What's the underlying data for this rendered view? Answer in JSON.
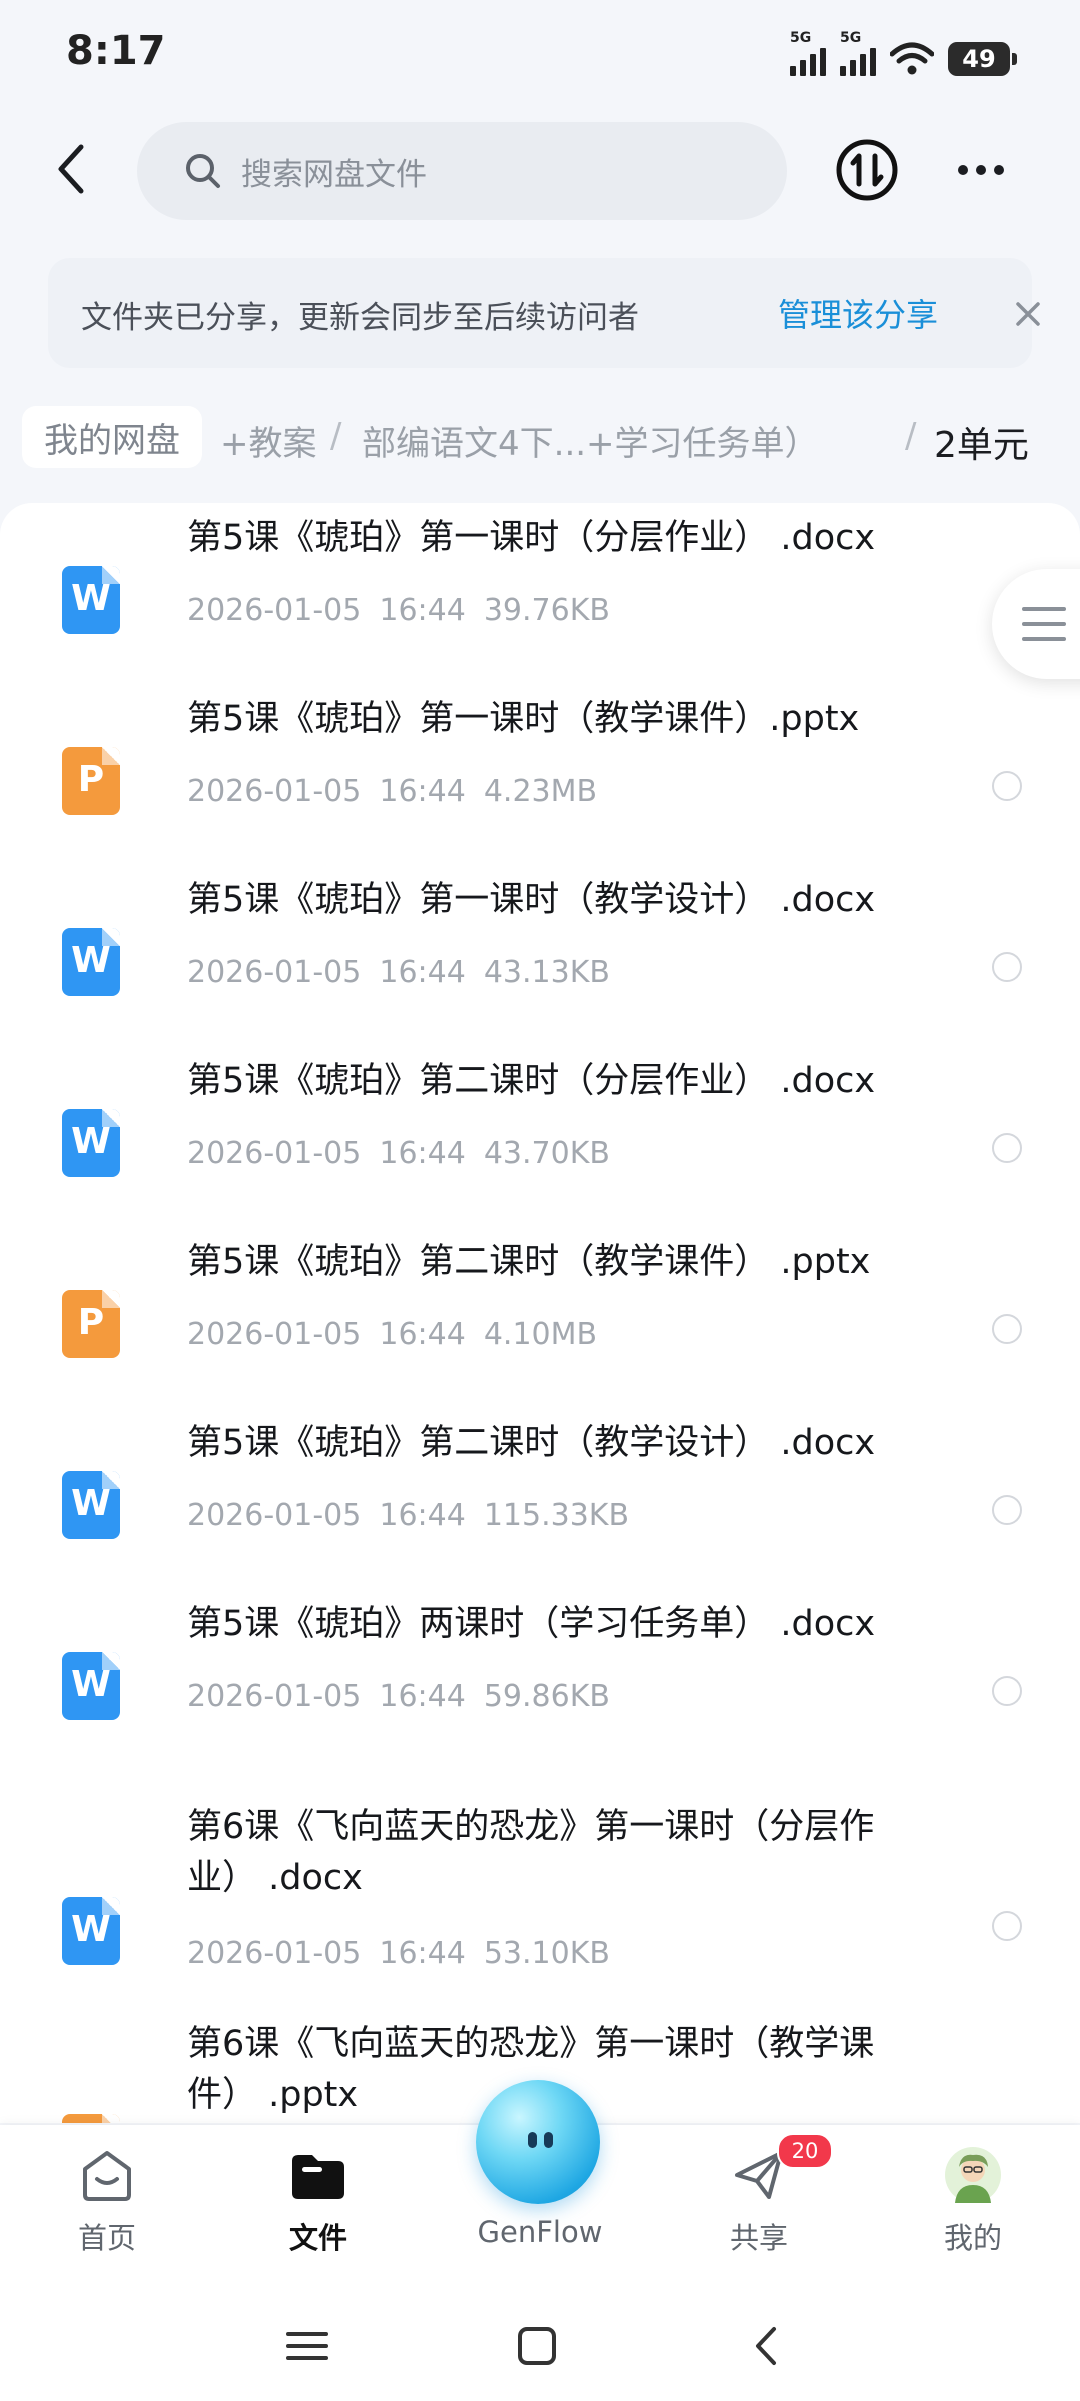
{
  "status_bar": {
    "time": "8:17",
    "signal_1": "5G",
    "signal_2": "5G",
    "battery": "49"
  },
  "header": {
    "search_placeholder": "搜索网盘文件"
  },
  "notice": {
    "text": "文件夹已分享，更新会同步至后续访问者",
    "action": "管理该分享"
  },
  "breadcrumb": {
    "root": "我的网盘",
    "level1": "+教案",
    "level2": "部编语文4下...+学习任务单）",
    "current": "2单元",
    "separator": "/"
  },
  "files": [
    {
      "type": "W",
      "name": "第5课《琥珀》第一课时（分层作业） .docx",
      "date": "2026-01-05",
      "time": "16:44",
      "size": "39.76KB"
    },
    {
      "type": "P",
      "name": "第5课《琥珀》第一课时（教学课件）.pptx",
      "date": "2026-01-05",
      "time": "16:44",
      "size": "4.23MB"
    },
    {
      "type": "W",
      "name": "第5课《琥珀》第一课时（教学设计） .docx",
      "date": "2026-01-05",
      "time": "16:44",
      "size": "43.13KB"
    },
    {
      "type": "W",
      "name": "第5课《琥珀》第二课时（分层作业） .docx",
      "date": "2026-01-05",
      "time": "16:44",
      "size": "43.70KB"
    },
    {
      "type": "P",
      "name": "第5课《琥珀》第二课时（教学课件） .pptx",
      "date": "2026-01-05",
      "time": "16:44",
      "size": "4.10MB"
    },
    {
      "type": "W",
      "name": "第5课《琥珀》第二课时（教学设计） .docx",
      "date": "2026-01-05",
      "time": "16:44",
      "size": "115.33KB"
    },
    {
      "type": "W",
      "name": "第5课《琥珀》两课时（学习任务单） .docx",
      "date": "2026-01-05",
      "time": "16:44",
      "size": "59.86KB"
    },
    {
      "type": "W",
      "name": "第6课《飞向蓝天的恐龙》第一课时（分层作业） .docx",
      "date": "2026-01-05",
      "time": "16:44",
      "size": "53.10KB"
    },
    {
      "type": "P",
      "name": "第6课《飞向蓝天的恐龙》第一课时（教学课件） .pptx",
      "date": "",
      "time": "",
      "size": ""
    }
  ],
  "bottom_nav": {
    "home": "首页",
    "files": "文件",
    "genflow": "GenFlow",
    "share": "共享",
    "share_badge": "20",
    "mine": "我的"
  },
  "icons": {
    "back": "back-arrow-icon",
    "search": "search-icon",
    "sync": "transfer-icon",
    "more": "more-icon",
    "close": "close-icon",
    "side": "menu-lines-icon"
  },
  "colors": {
    "accent_link": "#1a8fd8",
    "word_icon": "#2f96f3",
    "ppt_icon": "#f49a3d",
    "badge": "#f2384b"
  }
}
